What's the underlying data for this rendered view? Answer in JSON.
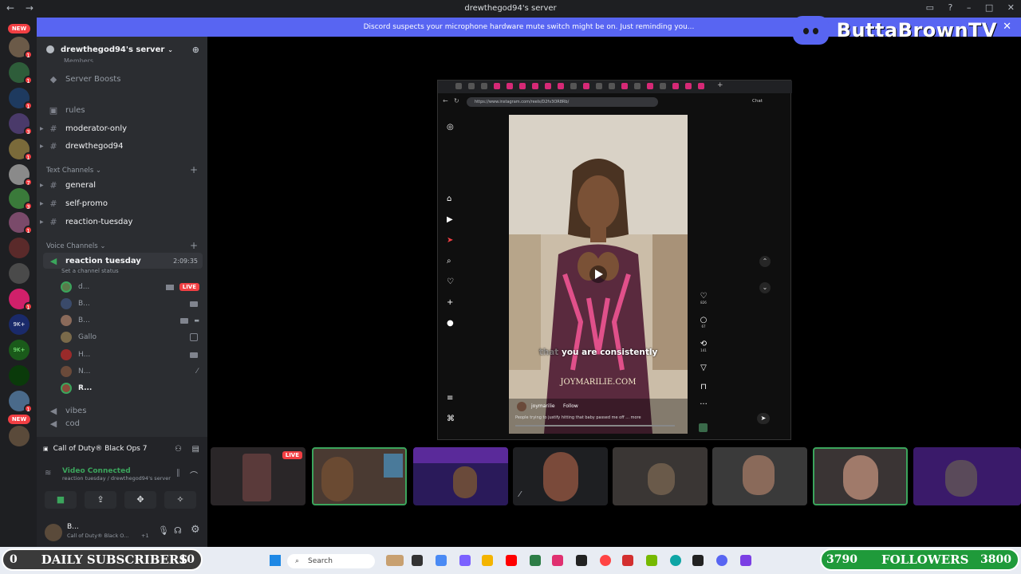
{
  "window": {
    "title": "drewthegod94's server",
    "nav_back": "←",
    "nav_fwd": "→"
  },
  "notice": {
    "text": "Discord suspects your microphone hardware mute switch might be on. Just reminding you...",
    "close": "✕"
  },
  "servers": {
    "new_top": "NEW",
    "new_bottom": "NEW",
    "badges": [
      "1",
      "1",
      "1",
      "3",
      "1",
      "7",
      "3",
      "1",
      "1",
      "1",
      "1",
      "1"
    ],
    "labels": [
      "9K+",
      "9K+"
    ]
  },
  "sidebar": {
    "server_name": "drewthegod94's server",
    "cut_item": "Members",
    "boosts": "Server Boosts",
    "channels_top": [
      {
        "name": "rules",
        "prefix": "▣"
      },
      {
        "name": "moderator-only",
        "prefix": "#"
      },
      {
        "name": "drewthegod94",
        "prefix": "#"
      }
    ],
    "text_cat": "Text Channels",
    "text_channels": [
      "general",
      "self-promo",
      "reaction-tuesday"
    ],
    "voice_cat": "Voice Channels",
    "voice_channel": "reaction tuesday",
    "voice_timer": "2:09:35",
    "voice_status": "Set a channel status",
    "voice_users": [
      "d...",
      "B...",
      "B...",
      "Gallo",
      "H...",
      "N...",
      "R..."
    ],
    "live_label": "LIVE",
    "more_channels": [
      "vibes",
      "cod"
    ]
  },
  "panel": {
    "activity": "Call of Duty® Black Ops 7",
    "video_connected": "Video Connected",
    "connection_sub": "reaction tuesday / drewthegod94's server",
    "user_name": "B...",
    "user_status": "Call of Duty® Black O...",
    "user_extra": "+1"
  },
  "browser": {
    "url": "https://www.instagram.com/reels/D2fv3OR8Rb/",
    "caption_hl": "that",
    "caption": " you are consistently",
    "watermark": "JOYMARILIE.COM",
    "poster": "joymarilie",
    "follow": "Follow",
    "post_text": "People trying to justify hitting that baby passed me off ... more",
    "likes": "826",
    "comments": "67",
    "reposts": "141",
    "chat_label": "Chat"
  },
  "tiles": {
    "live_label": "LIVE"
  },
  "taskbar": {
    "search": "Search"
  },
  "counters": {
    "subs_left_num": "0",
    "subs_label": "DAILY SUBSCRIBERS",
    "subs_right_num": "10",
    "foll_left_num": "3790",
    "foll_label": "FOLLOWERS",
    "foll_right_num": "3800",
    "subs_color": "#3a3a3a",
    "foll_color": "#1f9a3a"
  },
  "brand": {
    "name": "ButtaBrownTV"
  }
}
